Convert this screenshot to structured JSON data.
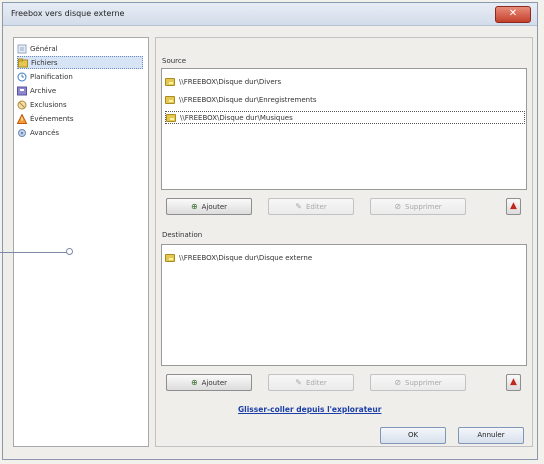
{
  "window": {
    "title": "Freebox vers disque externe",
    "close_glyph": "✕"
  },
  "sidebar": {
    "items": [
      {
        "label": "Général",
        "icon": "general-icon",
        "color": "#9aa9c4"
      },
      {
        "label": "Fichiers",
        "icon": "files-icon",
        "color": "#c9a13a"
      },
      {
        "label": "Planification",
        "icon": "schedule-icon",
        "color": "#3b7bc4"
      },
      {
        "label": "Archive",
        "icon": "archive-icon",
        "color": "#6a63b5"
      },
      {
        "label": "Exclusions",
        "icon": "exclusions-icon",
        "color": "#b28a3a"
      },
      {
        "label": "Événements",
        "icon": "events-icon",
        "color": "#d06a20"
      },
      {
        "label": "Avancés",
        "icon": "advanced-icon",
        "color": "#6b88b8"
      }
    ],
    "selected": "Fichiers"
  },
  "source": {
    "label": "Source",
    "items": [
      "\\\\FREEBOX\\Disque dur\\Divers",
      "\\\\FREEBOX\\Disque dur\\Enregistrements",
      "\\\\FREEBOX\\Disque dur\\Musiques"
    ],
    "buttons": {
      "add": "Ajouter",
      "edit": "Editer",
      "delete": "Supprimer"
    }
  },
  "destination": {
    "label": "Destination",
    "items": [
      "\\\\FREEBOX\\Disque dur\\Disque externe"
    ],
    "buttons": {
      "add": "Ajouter",
      "edit": "Editer",
      "delete": "Supprimer"
    }
  },
  "link": "Glisser-coller depuis l'explorateur",
  "footer": {
    "ok": "OK",
    "cancel": "Annuler"
  },
  "glyphs": {
    "add": "⊕",
    "edit": "✎",
    "delete": "⊘",
    "up": "▲"
  }
}
